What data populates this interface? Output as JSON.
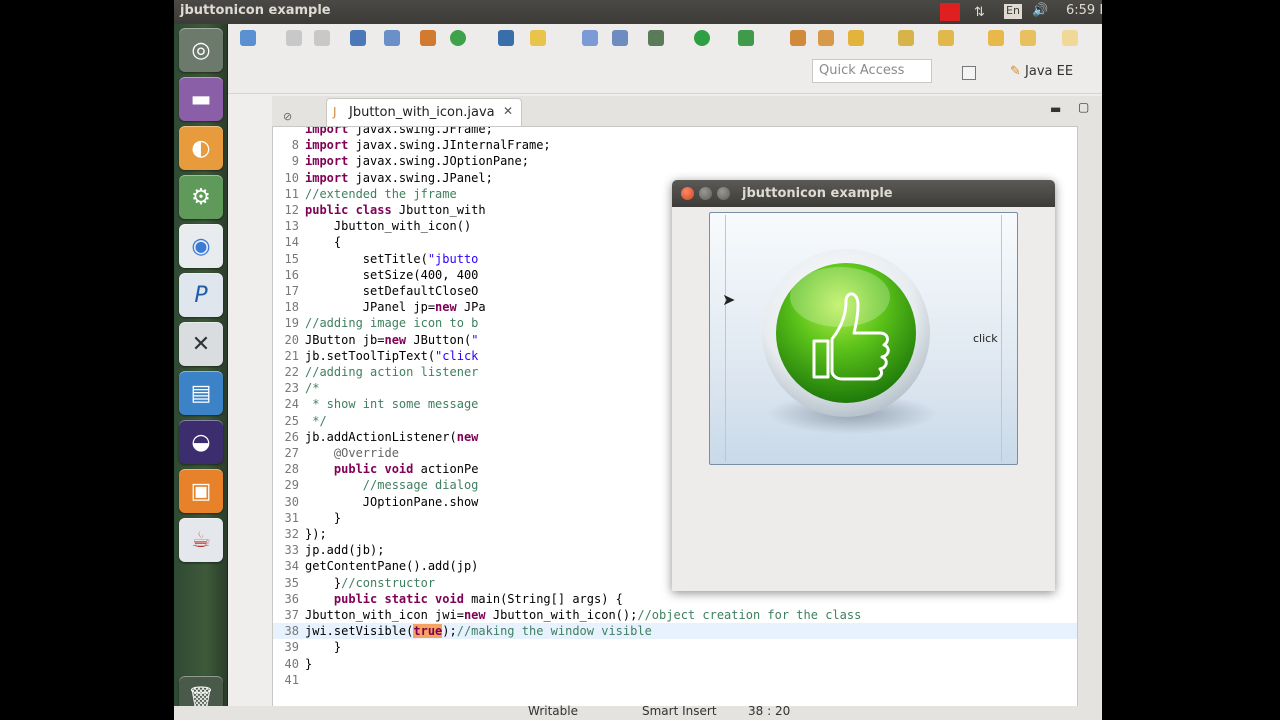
{
  "top_panel": {
    "window_title": "jbuttonicon example",
    "clock": "6:59 P",
    "keyboard_layout": "En"
  },
  "launcher": {
    "items": [
      "dash-home",
      "files",
      "ubuntu-software",
      "system-settings",
      "chromium",
      "pspp",
      "xmind",
      "documents",
      "eclipse",
      "impress",
      "java"
    ]
  },
  "eclipse": {
    "quick_access_placeholder": "Quick Access",
    "perspective": "Java EE",
    "editor_tab": "Jbutton_with_icon.java",
    "code_lines": [
      {
        "n": "",
        "html": "<span class='k'>import</span> javax.swing.JFrame;"
      },
      {
        "n": "8",
        "html": "<span class='k'>import</span> javax.swing.JInternalFrame;"
      },
      {
        "n": "9",
        "html": "<span class='k'>import</span> javax.swing.JOptionPane;"
      },
      {
        "n": "10",
        "html": "<span class='k'>import</span> javax.swing.JPanel;"
      },
      {
        "n": "11",
        "html": "<span class='c'>//extended the jframe</span>"
      },
      {
        "n": "12",
        "html": "<span class='k'>public class</span> Jbutton_with"
      },
      {
        "n": "13",
        "html": "    Jbutton_with_icon()"
      },
      {
        "n": "14",
        "html": "    {"
      },
      {
        "n": "15",
        "html": "        setTitle(<span class='s'>\"jbutto</span>"
      },
      {
        "n": "16",
        "html": "        setSize(400, 400                                    <span class='c'>w</span>"
      },
      {
        "n": "17",
        "html": "        setDefaultCloseO                                    <span class='c'>hen close icon clicked</span>"
      },
      {
        "n": "18",
        "html": "        JPanel jp=<span class='k'>new</span> JPa                                    <span class='c'>on</span>"
      },
      {
        "n": "19",
        "html": "<span class='c'>//adding image icon to b</span>"
      },
      {
        "n": "20",
        "html": "JButton jb=<span class='k'>new</span> JButton(<span class='s'>\"</span>                                  <span class='s'>epticon.png\"</span>));"
      },
      {
        "n": "21",
        "html": "jb.setToolTipText(<span class='s'>\"click</span>"
      },
      {
        "n": "22",
        "html": "<span class='c'>//adding action listener</span>"
      },
      {
        "n": "23",
        "html": "<span class='c'>/*</span>"
      },
      {
        "n": "24",
        "html": "<span class='c'> * show int some message</span>"
      },
      {
        "n": "25",
        "html": "<span class='c'> */</span>"
      },
      {
        "n": "26",
        "html": "jb.addActionListener(<span class='k'>new</span>"
      },
      {
        "n": "27",
        "html": "    <span class='a'>@Override</span>"
      },
      {
        "n": "28",
        "html": "    <span class='k'>public void</span> actionPe"
      },
      {
        "n": "29",
        "html": "        <span class='c'>//message dialog</span>"
      },
      {
        "n": "30",
        "html": "        JOptionPane.show                                  <span class='s'>!\"</span>);"
      },
      {
        "n": "31",
        "html": "    }"
      },
      {
        "n": "32",
        "html": "});"
      },
      {
        "n": "33",
        "html": "jp.add(jb);"
      },
      {
        "n": "34",
        "html": "getContentPane().add(jp)"
      },
      {
        "n": "35",
        "html": "    }<span class='c'>//constructor</span>"
      },
      {
        "n": "36",
        "html": "    <span class='k'>public static void</span> main(String[] args) {"
      },
      {
        "n": "37",
        "html": "Jbutton_with_icon jwi=<span class='k'>new</span> Jbutton_with_icon();<span class='c'>//object creation for the class</span>"
      },
      {
        "n": "38",
        "html": "jwi.setVisible(<span class='k' style='background:#f4a460'>true</span>);<span class='c'>//making the window visible</span>"
      },
      {
        "n": "39",
        "html": "    }"
      },
      {
        "n": "40",
        "html": "}"
      },
      {
        "n": "41",
        "html": ""
      }
    ],
    "status": {
      "writable": "Writable",
      "insert_mode": "Smart Insert",
      "position": "38 : 20"
    }
  },
  "java_window": {
    "title": "jbuttonicon example",
    "button_label": "click"
  }
}
